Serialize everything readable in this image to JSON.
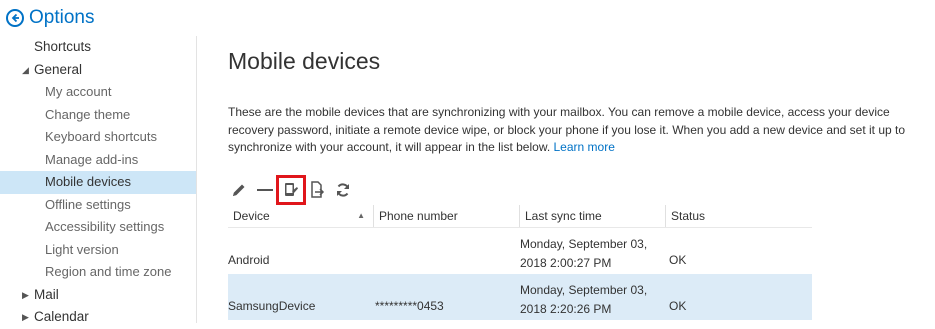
{
  "header": {
    "title": "Options"
  },
  "sidebar": {
    "shortcuts": "Shortcuts",
    "general": "General",
    "items": [
      "My account",
      "Change theme",
      "Keyboard shortcuts",
      "Manage add-ins",
      "Mobile devices",
      "Offline settings",
      "Accessibility settings",
      "Light version",
      "Region and time zone"
    ],
    "mail": "Mail",
    "calendar": "Calendar"
  },
  "main": {
    "title": "Mobile devices",
    "description": "These are the mobile devices that are synchronizing with your mailbox. You can remove a mobile device, access your device recovery password, initiate a remote device wipe, or block your phone if you lose it. When you add a new device and set it up to synchronize with your account, it will appear in the list below. ",
    "learn_more": "Learn more"
  },
  "toolbar": {
    "icons": [
      "pencil-icon",
      "minus-icon",
      "wipe-device-icon",
      "export-icon",
      "refresh-icon"
    ],
    "highlight_color": "#e0161b"
  },
  "table": {
    "columns": [
      "Device",
      "Phone number",
      "Last sync time",
      "Status"
    ],
    "rows": [
      {
        "device": "Android",
        "phone": "",
        "sync_date": "Monday, September 03,",
        "sync_time": "2018 2:00:27 PM",
        "status": "OK"
      },
      {
        "device": "SamsungDevice",
        "phone": "*********0453",
        "sync_date": "Monday, September 03,",
        "sync_time": "2018 2:20:26 PM",
        "status": "OK"
      }
    ]
  },
  "colors": {
    "accent": "#0072c6",
    "selected_nav": "#cde6f7",
    "selected_row": "#dcebf7"
  }
}
